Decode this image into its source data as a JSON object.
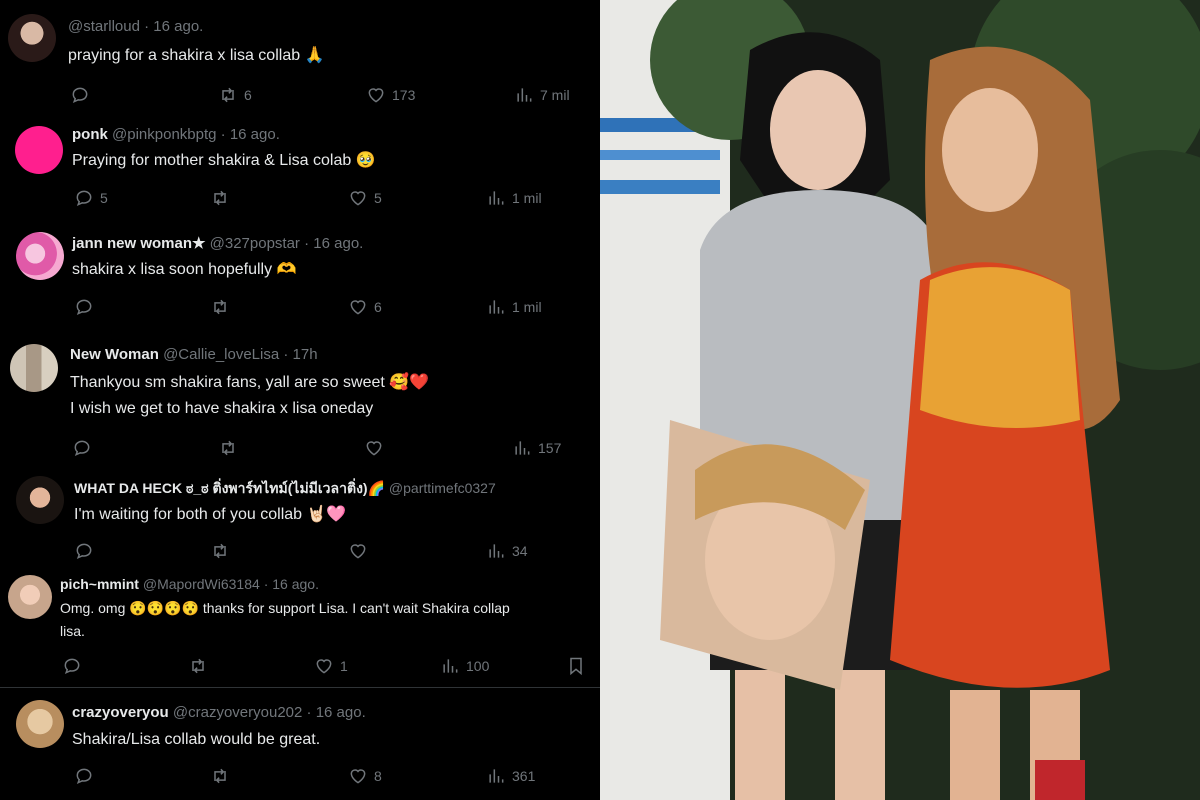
{
  "tweets": [
    {
      "name": "",
      "handle": "@starlloud",
      "sep": "·",
      "time": "16 ago.",
      "text": "praying for a shakira x lisa collab 🙏",
      "retweets": "6",
      "likes": "173",
      "views": "7 mil",
      "replies": ""
    },
    {
      "name": "ponk",
      "handle": "@pinkponkbptg",
      "sep": "·",
      "time": "16 ago.",
      "text": "Praying for mother shakira & Lisa colab 🥹",
      "replies": "5",
      "retweets": "",
      "likes": "5",
      "views": "1 mil"
    },
    {
      "name": "jann new woman★",
      "handle": "@327popstar",
      "sep": "·",
      "time": "16 ago.",
      "text": "shakira x lisa soon hopefully 🫶",
      "replies": "",
      "retweets": "",
      "likes": "6",
      "views": "1 mil"
    },
    {
      "name": "New Woman",
      "handle": "@Callie_loveLisa",
      "sep": "·",
      "time": "17h",
      "text": "Thankyou sm shakira fans, yall are so sweet 🥰❤️",
      "text2": "I wish we get to have shakira x lisa oneday",
      "replies": "",
      "retweets": "",
      "likes": "",
      "views": "157"
    },
    {
      "name": "WHAT DA HECK ಠ_ಠ ติ่งพาร์ทไทม์(ไม่มีเวลาติ่ง)🌈",
      "handle": "@parttimefc0327",
      "text": "I'm waiting for both of you collab 🤘🏻🩷",
      "replies": "",
      "retweets": "",
      "likes": "",
      "views": "34"
    },
    {
      "name": "pich~mmint",
      "handle": "@MapordWi63184",
      "sep": "·",
      "time": "16 ago.",
      "text": "Omg. omg 😯😯😯😯 thanks for support Lisa. I can't wait Shakira collap",
      "text2": "lisa.",
      "replies": "",
      "retweets": "",
      "likes": "1",
      "views": "100"
    },
    {
      "name": "crazyoveryou",
      "handle": "@crazyoveryou202",
      "sep": "·",
      "time": "16 ago.",
      "text": "Shakira/Lisa collab would be great.",
      "replies": "",
      "retweets": "",
      "likes": "8",
      "views": "361"
    }
  ],
  "icons": {
    "reply": "reply-icon",
    "retweet": "retweet-icon",
    "like": "heart-icon",
    "views": "views-icon",
    "bookmark": "bookmark-icon"
  },
  "colors": {
    "background": "#000000",
    "text": "#e7e9ea",
    "muted": "#71767b",
    "separator": "#2f3336",
    "ponk_avatar": "#ff1f8e"
  }
}
